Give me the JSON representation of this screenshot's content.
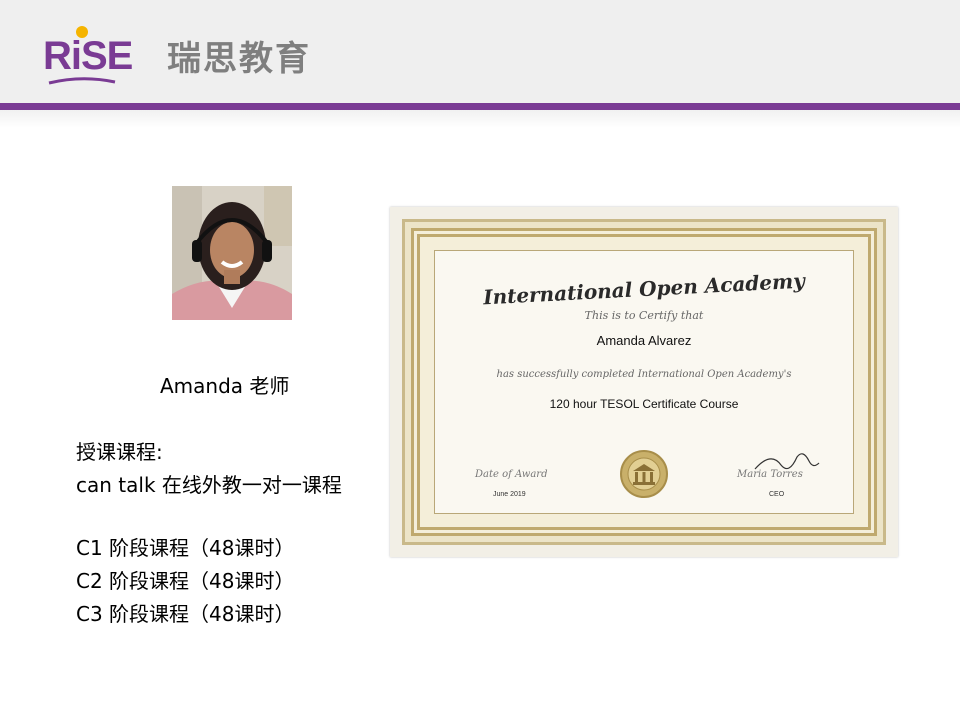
{
  "header": {
    "logo_text": "RiSE",
    "logo_cn": "瑞思教育"
  },
  "teacher": {
    "name": "Amanda 老师",
    "photo_icon": "teacher-photo"
  },
  "courses": {
    "heading": "授课课程:",
    "program": "can talk 在线外教一对一课程",
    "levels": [
      "C1 阶段课程（48课时）",
      "C2 阶段课程（48课时）",
      "C3 阶段课程（48课时）"
    ]
  },
  "certificate": {
    "title": "International Open Academy",
    "certify": "This is to Certify that",
    "recipient": "Amanda Alvarez",
    "completed": "has successfully completed International Open Academy's",
    "course": "120 hour TESOL Certificate Course",
    "date_label": "Date of Award",
    "date": "June 2019",
    "signer": "Maria Torres",
    "role": "CEO"
  },
  "colors": {
    "brand_purple": "#7a3b94",
    "brand_yellow": "#f5b400",
    "cert_gold": "#bfa96e"
  }
}
